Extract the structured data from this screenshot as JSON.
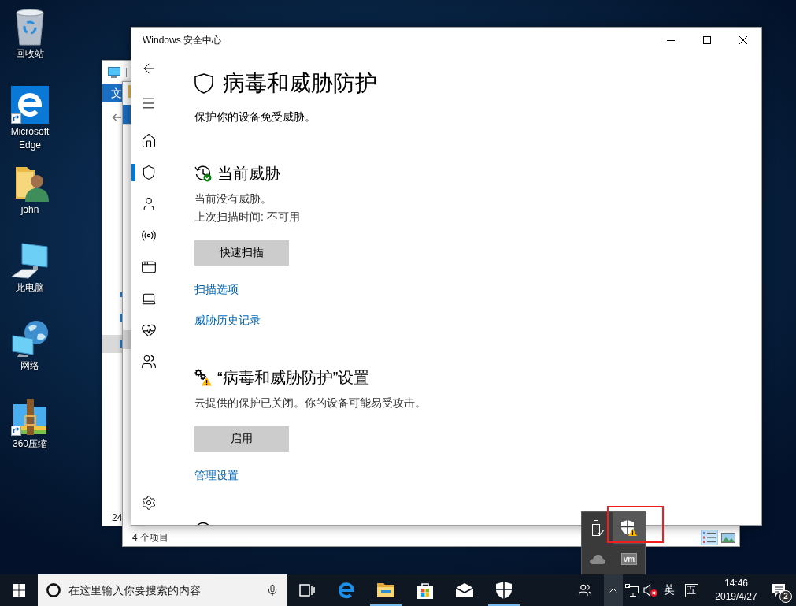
{
  "desktop_icons": [
    {
      "label": "回收站",
      "kind": "recycle-bin",
      "shortcut": false
    },
    {
      "label": "Microsoft Edge",
      "kind": "edge",
      "shortcut": true
    },
    {
      "label": "john",
      "kind": "user-folder",
      "shortcut": false
    },
    {
      "label": "此电脑",
      "kind": "computer",
      "shortcut": false
    },
    {
      "label": "网络",
      "kind": "network",
      "shortcut": false
    },
    {
      "label": "360压缩",
      "kind": "archiver",
      "shortcut": true
    }
  ],
  "explorer_back": {
    "ribbon_tab": "文",
    "status": "24"
  },
  "explorer_front": {
    "status": "4 个项目",
    "views": [
      {
        "kind": "details",
        "selected": true
      },
      {
        "kind": "large-icons",
        "selected": false
      }
    ]
  },
  "security_window": {
    "title": "Windows 安全中心",
    "nav": [
      {
        "kind": "home",
        "selected": false
      },
      {
        "kind": "virus-protection",
        "selected": true
      },
      {
        "kind": "account",
        "selected": false
      },
      {
        "kind": "firewall",
        "selected": false
      },
      {
        "kind": "app-browser",
        "selected": false
      },
      {
        "kind": "device-security",
        "selected": false
      },
      {
        "kind": "device-health",
        "selected": false
      },
      {
        "kind": "family",
        "selected": false
      }
    ],
    "heading": "病毒和威胁防护",
    "subtitle": "保护你的设备免受威胁。",
    "sections": [
      {
        "kind": "status-ok",
        "title": "当前威胁",
        "lines": [
          "当前没有威胁。",
          "上次扫描时间: 不可用"
        ],
        "button": "快速扫描",
        "links": [
          "扫描选项",
          "威胁历史记录"
        ]
      },
      {
        "kind": "warning",
        "title": "“病毒和威胁防护”设置",
        "lines": [
          "云提供的保护已关闭。你的设备可能易受攻击。"
        ],
        "button": "启用",
        "links": [
          "管理设置"
        ]
      },
      {
        "kind": "update"
      }
    ]
  },
  "tray_flyout": {
    "icons": [
      {
        "kind": "usb",
        "highlighted": false
      },
      {
        "kind": "security-warning",
        "highlighted": true
      },
      {
        "kind": "onedrive",
        "highlighted": false
      },
      {
        "kind": "vmware",
        "label": "vm",
        "highlighted": false
      }
    ]
  },
  "taskbar": {
    "search": {
      "placeholder": "在这里输入你要搜索的内容"
    },
    "apps": [
      {
        "kind": "task-view",
        "running": false
      },
      {
        "kind": "edge",
        "running": false
      },
      {
        "kind": "file-explorer",
        "running": true
      },
      {
        "kind": "store",
        "running": false
      },
      {
        "kind": "mail",
        "running": false
      },
      {
        "kind": "security",
        "running": true
      }
    ],
    "tray": {
      "expanded": true,
      "muted": true,
      "language": "英",
      "ime": "五",
      "time": "14:46",
      "date": "2019/4/27",
      "notifications": "2"
    }
  }
}
